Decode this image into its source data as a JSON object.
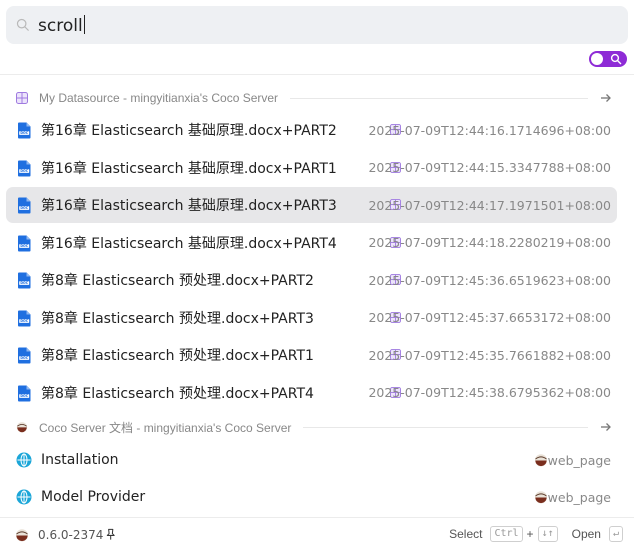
{
  "search": {
    "value": "scroll"
  },
  "colors": {
    "accent": "#8e2bd6",
    "doc_blue": "#1f6fe0",
    "web_teal": "#1ba6d8",
    "selected_bg": "#e7e7e9"
  },
  "groups": [
    {
      "title": "My Datasource - mingyitianxia's Coco Server",
      "icon": "datasource-grid-icon",
      "items": [
        {
          "title": "第16章 Elasticsearch 基础原理.docx+PART2",
          "meta": "2025-07-09T12:44:16.1714696+08:00",
          "icon": "doc-file-icon"
        },
        {
          "title": "第16章 Elasticsearch 基础原理.docx+PART1",
          "meta": "2025-07-09T12:44:15.3347788+08:00",
          "icon": "doc-file-icon"
        },
        {
          "title": "第16章 Elasticsearch 基础原理.docx+PART3",
          "meta": "2025-07-09T12:44:17.1971501+08:00",
          "icon": "doc-file-icon",
          "selected": true
        },
        {
          "title": "第16章 Elasticsearch 基础原理.docx+PART4",
          "meta": "2025-07-09T12:44:18.2280219+08:00",
          "icon": "doc-file-icon"
        },
        {
          "title": "第8章 Elasticsearch 预处理.docx+PART2",
          "meta": "2025-07-09T12:45:36.6519623+08:00",
          "icon": "doc-file-icon"
        },
        {
          "title": "第8章 Elasticsearch 预处理.docx+PART3",
          "meta": "2025-07-09T12:45:37.6653172+08:00",
          "icon": "doc-file-icon"
        },
        {
          "title": "第8章 Elasticsearch 预处理.docx+PART1",
          "meta": "2025-07-09T12:45:35.7661882+08:00",
          "icon": "doc-file-icon"
        },
        {
          "title": "第8章 Elasticsearch 预处理.docx+PART4",
          "meta": "2025-07-09T12:45:38.6795362+08:00",
          "icon": "doc-file-icon"
        }
      ]
    },
    {
      "title": "Coco Server 文档 - mingyitianxia's Coco Server",
      "icon": "coco-logo-icon",
      "items": [
        {
          "title": "Installation",
          "meta": "web_page",
          "icon": "globe-icon"
        },
        {
          "title": "Model Provider",
          "meta": "web_page",
          "icon": "globe-icon"
        }
      ]
    }
  ],
  "footer": {
    "version": "0.6.0-2374",
    "select_label": "Select",
    "select_key1": "Ctrl",
    "plus": "+",
    "select_key2": "↓↑",
    "open_label": "Open",
    "open_key": "↵"
  }
}
